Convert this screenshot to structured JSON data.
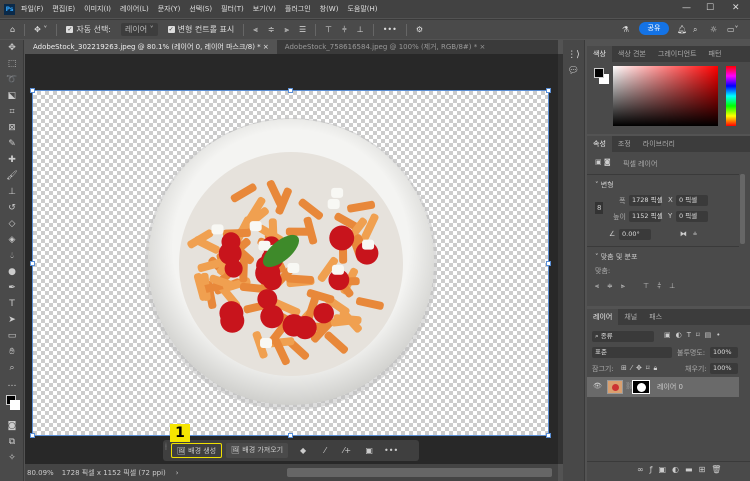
{
  "app": {
    "logo": "Ps"
  },
  "menu": [
    "파일(F)",
    "편집(E)",
    "이미지(I)",
    "레이어(L)",
    "문자(Y)",
    "선택(S)",
    "필터(T)",
    "보기(V)",
    "플러그인",
    "창(W)",
    "도움말(H)"
  ],
  "window_controls": {
    "minimize": "—",
    "maximize": "☐",
    "close": "✕"
  },
  "options": {
    "auto_select_label": "자동 선택:",
    "auto_select_value": "레이어",
    "show_transform_label": "변형 컨트롤 표시",
    "more": "•••",
    "share": "공유"
  },
  "tabs": [
    {
      "label": "AdobeStock_302219263.jpeg @ 80.1% (레이어 0, 레이어 마스크/8) *",
      "active": true
    },
    {
      "label": "AdobeStock_758616584.jpeg @ 100% (제거, RGB/8#) *",
      "active": false
    }
  ],
  "context_bar": {
    "step_badge": "1",
    "generate_bg": "배경 생성",
    "import_bg": "배경 가져오기",
    "more": "•••"
  },
  "status": {
    "zoom": "80.09%",
    "doc_info": "1728 픽셀 x 1152 픽셀 (72 ppi)"
  },
  "color_panel": {
    "tabs": [
      "색상",
      "색상 견본",
      "그레이디언트",
      "패턴"
    ],
    "foreground": "#000000",
    "background": "#ffffff",
    "hue": "#ff0000"
  },
  "properties_panel": {
    "tabs": [
      "속성",
      "조정",
      "라이브러리"
    ],
    "layer_type": "픽셀 레이어",
    "transform": {
      "title": "변형",
      "w_label": "폭",
      "w": "1728 픽셀",
      "h_label": "높이",
      "h": "1152 픽셀",
      "x_label": "X",
      "x": "0 픽셀",
      "y_label": "Y",
      "y": "0 픽셀",
      "angle": "0.00°"
    },
    "align": {
      "title": "맞춤 및 분포",
      "label": "맞춤:"
    }
  },
  "layers_panel": {
    "tabs": [
      "레이어",
      "채널",
      "패스"
    ],
    "filter": "종류",
    "blend_mode": "표준",
    "opacity_label": "불투명도:",
    "opacity": "100%",
    "lock_label": "잠그기:",
    "fill_label": "채우기:",
    "fill": "100%",
    "layers": [
      {
        "name": "레이어 0",
        "visible": true
      }
    ]
  }
}
